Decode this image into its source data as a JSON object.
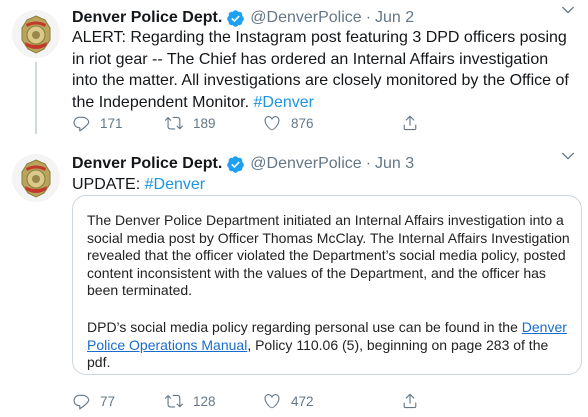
{
  "tweets": [
    {
      "author_name": "Denver Police Dept.",
      "handle": "@DenverPolice",
      "separator": "·",
      "date": "Jun 2",
      "text_main": "ALERT: Regarding the Instagram post featuring 3 DPD officers posing in riot gear -- The Chief has ordered an Internal Affairs investigation into the matter. All investigations are closely monitored by the Office of the Independent Monitor.",
      "hashtag": "#Denver",
      "replies": "171",
      "retweets": "189",
      "likes": "876"
    },
    {
      "author_name": "Denver Police Dept.",
      "handle": "@DenverPolice",
      "separator": "·",
      "date": "Jun 3",
      "text_main": "UPDATE:",
      "hashtag": "#Denver",
      "image_paragraph_1": "The Denver Police Department initiated an Internal Affairs investigation into a social media post by Officer Thomas McClay. The Internal Affairs Investigation revealed that the officer violated the Department’s social media policy, posted content inconsistent with the values of the Department, and the officer has been terminated.",
      "image_paragraph_2_before": "DPD’s social media policy regarding personal use can be found in the",
      "image_link": "Denver Police Operations Manual",
      "image_paragraph_2_after": ", Policy 110.06 (5), beginning on page 283 of the pdf.",
      "replies": "77",
      "retweets": "128",
      "likes": "472"
    }
  ],
  "colors": {
    "link": "#1b95e0",
    "verified": "#1da1f2",
    "muted": "#657786",
    "divider": "#e6ecf0"
  },
  "icons": [
    "police-badge-avatar",
    "verified-badge-icon",
    "chevron-down-icon",
    "reply-icon",
    "retweet-icon",
    "like-icon",
    "share-icon"
  ]
}
